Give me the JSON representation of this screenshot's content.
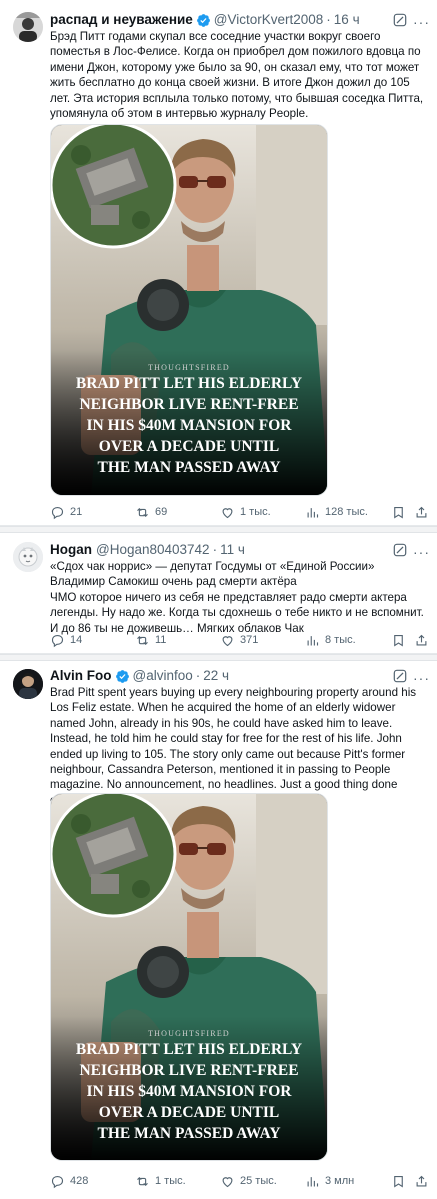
{
  "tweets": [
    {
      "name": "распад и неуважение",
      "handle": "@VictorKvert2008",
      "dot": "·",
      "time": "16 ч",
      "text": "Брэд Питт годами скупал все соседние участки вокруг своего поместья в Лос-Фелисе. Когда он приобрел дом пожилого вдовца по имени Джон, которому уже было за 90, он сказал ему, что тот может жить бесплатно до конца своей жизни. В итоге Джон дожил до 105 лет. Эта история всплыла только потому, что бывшая соседка Питта, упомянула об этом в интервью журналу People.",
      "media": {
        "source": "THOUGHTSFIRED",
        "caption": [
          "BRAD PITT LET HIS ELDERLY",
          "NEIGHBOR LIVE RENT-FREE",
          "IN HIS $40M MANSION FOR",
          "OVER A DECADE UNTIL",
          "THE MAN PASSED AWAY"
        ]
      },
      "stats": {
        "replies": "21",
        "reposts": "69",
        "likes": "1 тыс.",
        "views": "128 тыс."
      }
    },
    {
      "name": "Hogan",
      "handle": "@Hogan80403742",
      "dot": "·",
      "time": "11 ч",
      "text": "«Сдох чак норрис» — депутат Госдумы от «Единой России» Владимир Самокиш очень рад смерти актёра\nЧМО которое ничего из себя не представляет радо смерти актера легенды. Ну надо же. Когда ты сдохнешь о тебе никто и не вспомнит. И до 86 ты не доживешь… Мягких облаков Чак",
      "stats": {
        "replies": "14",
        "reposts": "11",
        "likes": "371",
        "views": "8 тыс."
      }
    },
    {
      "name": "Alvin Foo",
      "handle": "@alvinfoo",
      "dot": "·",
      "time": "22 ч",
      "text": "Brad Pitt spent years buying up every neighbouring property around his Los Feliz estate. When he acquired the home of an elderly widower named John, already in his 90s, he could have asked him to leave. Instead, he told him he could stay for free for the rest of his life. John ended up living to 105. The story only came out because Pitt's former neighbour, Cassandra Peterson, mentioned it in passing to People magazine. No announcement, no headlines. Just a good thing done quietly.",
      "media": {
        "source": "THOUGHTSFIRED",
        "caption": [
          "BRAD PITT LET HIS ELDERLY",
          "NEIGHBOR LIVE RENT-FREE",
          "IN HIS $40M MANSION FOR",
          "OVER A DECADE UNTIL",
          "THE MAN PASSED AWAY"
        ]
      },
      "stats": {
        "replies": "428",
        "reposts": "1 тыс.",
        "likes": "25 тыс.",
        "views": "3 млн"
      }
    }
  ],
  "colors": {
    "verified": "#1d9bf0",
    "muted": "#536471",
    "text": "#0f1419",
    "divider": "#e6e9eb"
  },
  "icons": [
    "verified-badge-icon",
    "grok-icon",
    "more-icon",
    "reply-icon",
    "repost-icon",
    "like-icon",
    "views-icon",
    "bookmark-icon",
    "share-icon"
  ]
}
